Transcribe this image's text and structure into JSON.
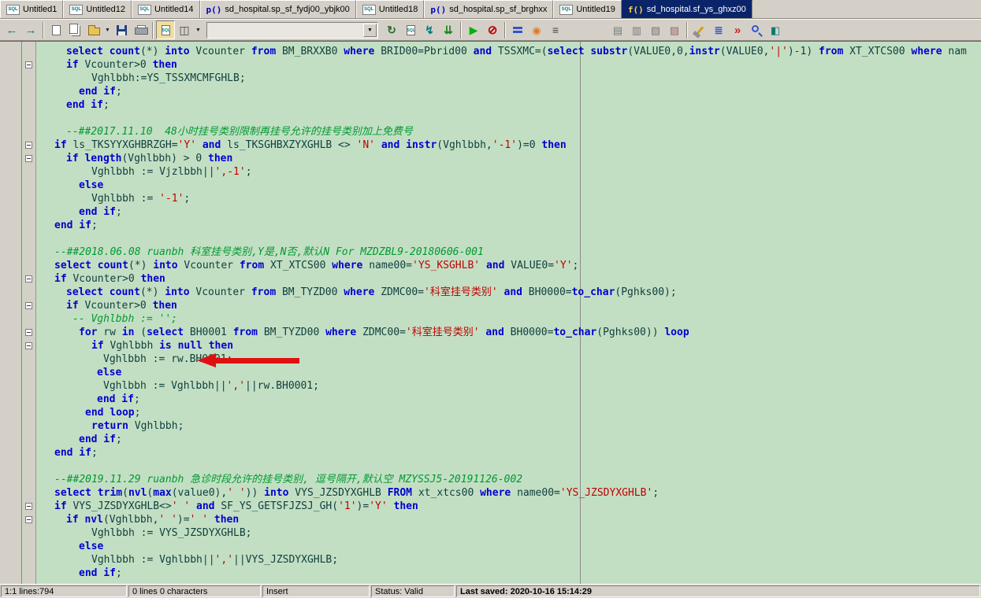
{
  "colors": {
    "window_bg": "#d4d0c8",
    "editor_bg": "#c3dfc3",
    "keyword": "#0000d0",
    "string": "#c00000",
    "comment": "#009933",
    "text": "#0e3e3e",
    "active_tab_bg": "#0a246a",
    "annotation_arrow": "#e01010"
  },
  "tab_icons": {
    "sql-window-icon": "SQL",
    "procedure-icon": "p()",
    "function-icon": "f()"
  },
  "tabs": [
    {
      "label": "Untitled1",
      "icon": "sql-window-icon",
      "active": false
    },
    {
      "label": "Untitled12",
      "icon": "sql-window-icon",
      "active": false
    },
    {
      "label": "Untitled14",
      "icon": "sql-window-icon",
      "active": false
    },
    {
      "label": "sd_hospital.sp_sf_fydj00_ybjk00",
      "icon": "procedure-icon",
      "active": false
    },
    {
      "label": "Untitled18",
      "icon": "sql-window-icon",
      "active": false
    },
    {
      "label": "sd_hospital.sp_sf_brghxx",
      "icon": "procedure-icon",
      "active": false
    },
    {
      "label": "Untitled19",
      "icon": "sql-window-icon",
      "active": false
    },
    {
      "label": "sd_hospital.sf_ys_ghxz00",
      "icon": "function-icon",
      "active": true
    }
  ],
  "toolbar": {
    "combo_value": "",
    "items": [
      {
        "type": "button",
        "name": "back-button",
        "icon": "arrow-left-icon"
      },
      {
        "type": "button",
        "name": "forward-button",
        "icon": "arrow-right-icon"
      },
      {
        "type": "sep"
      },
      {
        "type": "button",
        "name": "new-button",
        "icon": "new-page-icon"
      },
      {
        "type": "button",
        "name": "new-instance-button",
        "icon": "template-icon"
      },
      {
        "type": "button",
        "name": "open-button",
        "icon": "folder-icon",
        "dropdown": true
      },
      {
        "type": "button",
        "name": "save-button",
        "icon": "floppy-icon"
      },
      {
        "type": "button",
        "name": "print-button",
        "icon": "printer-icon"
      },
      {
        "type": "sep"
      },
      {
        "type": "button",
        "name": "sql-window-button",
        "icon": "sql-edit-icon",
        "pressed": true
      },
      {
        "type": "button",
        "name": "window-layout-button",
        "icon": "split-window-icon",
        "dropdown": true
      },
      {
        "type": "combo",
        "name": "session-selector-combo"
      },
      {
        "type": "button",
        "name": "refresh-button",
        "icon": "refresh-icon"
      },
      {
        "type": "button",
        "name": "execute-sql-button",
        "icon": "sql-page-icon"
      },
      {
        "type": "button",
        "name": "run-script-button",
        "icon": "lightning-icon"
      },
      {
        "type": "button",
        "name": "fetch-next-button",
        "icon": "double-down-icon"
      },
      {
        "type": "sep"
      },
      {
        "type": "button",
        "name": "execute-button",
        "icon": "play-icon"
      },
      {
        "type": "button",
        "name": "break-button",
        "icon": "stop-icon"
      },
      {
        "type": "sep"
      },
      {
        "type": "button",
        "name": "step-button",
        "icon": "dashes-icon"
      },
      {
        "type": "button",
        "name": "profiler-button",
        "icon": "donut-icon"
      },
      {
        "type": "button",
        "name": "statistics-button",
        "icon": "list-lines-icon"
      },
      {
        "type": "gap"
      },
      {
        "type": "button",
        "name": "copy-button",
        "icon": "clipboard-icon"
      },
      {
        "type": "button",
        "name": "copy-special-button",
        "icon": "clipboard2-icon"
      },
      {
        "type": "button",
        "name": "paste-button",
        "icon": "clipboard3-icon"
      },
      {
        "type": "button",
        "name": "edit-clipboard-button",
        "icon": "clipboard4-icon"
      },
      {
        "type": "sep"
      },
      {
        "type": "button",
        "name": "beautifier-button",
        "icon": "broom-icon"
      },
      {
        "type": "button",
        "name": "todo-list-button",
        "icon": "todo-icon"
      },
      {
        "type": "button",
        "name": "macro-button",
        "icon": "quotes-icon"
      },
      {
        "type": "button",
        "name": "find-button",
        "icon": "magnifier-icon"
      },
      {
        "type": "button",
        "name": "color-mark-button",
        "icon": "two-tone-icon"
      }
    ]
  },
  "code": {
    "lines": [
      {
        "indent": 4,
        "tokens": [
          [
            "k",
            "select"
          ],
          [
            "p",
            " "
          ],
          [
            "k",
            "count"
          ],
          [
            "p",
            "(*) "
          ],
          [
            "k",
            "into"
          ],
          [
            "p",
            " Vcounter "
          ],
          [
            "k",
            "from"
          ],
          [
            "p",
            " BM_BRXXB0 "
          ],
          [
            "k",
            "where"
          ],
          [
            "p",
            " BRID00=Pbrid00 "
          ],
          [
            "k",
            "and"
          ],
          [
            "p",
            " TSSXMC=("
          ],
          [
            "k",
            "select"
          ],
          [
            "p",
            " "
          ],
          [
            "k",
            "substr"
          ],
          [
            "p",
            "(VALUE0,0,"
          ],
          [
            "k",
            "instr"
          ],
          [
            "p",
            "(VALUE0,"
          ],
          [
            "s",
            "'|'"
          ],
          [
            "p",
            ")-1) "
          ],
          [
            "k",
            "from"
          ],
          [
            "p",
            " XT_XTCS00 "
          ],
          [
            "k",
            "where"
          ],
          [
            "p",
            " nam"
          ]
        ]
      },
      {
        "indent": 4,
        "fold": true,
        "tokens": [
          [
            "k",
            "if"
          ],
          [
            "p",
            " Vcounter>0 "
          ],
          [
            "k",
            "then"
          ]
        ]
      },
      {
        "indent": 8,
        "tokens": [
          [
            "p",
            "Vghlbbh:=YS_TSSXMCMFGHLB;"
          ]
        ]
      },
      {
        "indent": 6,
        "tokens": [
          [
            "k",
            "end if"
          ],
          [
            "p",
            ";"
          ]
        ]
      },
      {
        "indent": 4,
        "tokens": [
          [
            "k",
            "end if"
          ],
          [
            "p",
            ";"
          ]
        ]
      },
      {
        "indent": 0,
        "tokens": []
      },
      {
        "indent": 4,
        "tokens": [
          [
            "c",
            "--##2017.11.10  48小时挂号类别限制再挂号允许的挂号类别加上免费号"
          ]
        ]
      },
      {
        "indent": 2,
        "fold": true,
        "tokens": [
          [
            "k",
            "if"
          ],
          [
            "p",
            " ls_TKSYYXGHBRZGH="
          ],
          [
            "s",
            "'Y'"
          ],
          [
            "p",
            " "
          ],
          [
            "k",
            "and"
          ],
          [
            "p",
            " ls_TKSGHBXZYXGHLB <> "
          ],
          [
            "s",
            "'N'"
          ],
          [
            "p",
            " "
          ],
          [
            "k",
            "and"
          ],
          [
            "p",
            " "
          ],
          [
            "k",
            "instr"
          ],
          [
            "p",
            "(Vghlbbh,"
          ],
          [
            "s",
            "'-1'"
          ],
          [
            "p",
            ")=0 "
          ],
          [
            "k",
            "then"
          ]
        ]
      },
      {
        "indent": 4,
        "fold": true,
        "tokens": [
          [
            "k",
            "if"
          ],
          [
            "p",
            " "
          ],
          [
            "k",
            "length"
          ],
          [
            "p",
            "(Vghlbbh) > 0 "
          ],
          [
            "k",
            "then"
          ]
        ]
      },
      {
        "indent": 8,
        "tokens": [
          [
            "p",
            "Vghlbbh := Vjzlbbh||"
          ],
          [
            "s",
            "',-1'"
          ],
          [
            "p",
            ";"
          ]
        ]
      },
      {
        "indent": 6,
        "tokens": [
          [
            "k",
            "else"
          ]
        ]
      },
      {
        "indent": 8,
        "tokens": [
          [
            "p",
            "Vghlbbh := "
          ],
          [
            "s",
            "'-1'"
          ],
          [
            "p",
            ";"
          ]
        ]
      },
      {
        "indent": 6,
        "tokens": [
          [
            "k",
            "end if"
          ],
          [
            "p",
            ";"
          ]
        ]
      },
      {
        "indent": 2,
        "tokens": [
          [
            "k",
            "end if"
          ],
          [
            "p",
            ";"
          ]
        ]
      },
      {
        "indent": 0,
        "tokens": []
      },
      {
        "indent": 2,
        "tokens": [
          [
            "c",
            "--##2018.06.08 ruanbh 科室挂号类别,Y是,N否,默认N For MZDZBL9-20180606-001"
          ]
        ]
      },
      {
        "indent": 2,
        "tokens": [
          [
            "k",
            "select"
          ],
          [
            "p",
            " "
          ],
          [
            "k",
            "count"
          ],
          [
            "p",
            "(*) "
          ],
          [
            "k",
            "into"
          ],
          [
            "p",
            " Vcounter "
          ],
          [
            "k",
            "from"
          ],
          [
            "p",
            " XT_XTCS00 "
          ],
          [
            "k",
            "where"
          ],
          [
            "p",
            " name00="
          ],
          [
            "s",
            "'YS_KSGHLB'"
          ],
          [
            "p",
            " "
          ],
          [
            "k",
            "and"
          ],
          [
            "p",
            " VALUE0="
          ],
          [
            "s",
            "'Y'"
          ],
          [
            "p",
            ";"
          ]
        ]
      },
      {
        "indent": 2,
        "fold": true,
        "tokens": [
          [
            "k",
            "if"
          ],
          [
            "p",
            " Vcounter>0 "
          ],
          [
            "k",
            "then"
          ]
        ]
      },
      {
        "indent": 4,
        "tokens": [
          [
            "k",
            "select"
          ],
          [
            "p",
            " "
          ],
          [
            "k",
            "count"
          ],
          [
            "p",
            "(*) "
          ],
          [
            "k",
            "into"
          ],
          [
            "p",
            " Vcounter "
          ],
          [
            "k",
            "from"
          ],
          [
            "p",
            " BM_TYZD00 "
          ],
          [
            "k",
            "where"
          ],
          [
            "p",
            " ZDMC00="
          ],
          [
            "s",
            "'科室挂号类别'"
          ],
          [
            "p",
            " "
          ],
          [
            "k",
            "and"
          ],
          [
            "p",
            " BH0000="
          ],
          [
            "k",
            "to_char"
          ],
          [
            "p",
            "(Pghks00);"
          ]
        ]
      },
      {
        "indent": 4,
        "fold": true,
        "tokens": [
          [
            "k",
            "if"
          ],
          [
            "p",
            " Vcounter>0 "
          ],
          [
            "k",
            "then"
          ]
        ]
      },
      {
        "indent": 5,
        "tokens": [
          [
            "c",
            "-- Vghlbbh := '';"
          ]
        ]
      },
      {
        "indent": 6,
        "fold": true,
        "tokens": [
          [
            "k",
            "for"
          ],
          [
            "p",
            " rw "
          ],
          [
            "k",
            "in"
          ],
          [
            "p",
            " ("
          ],
          [
            "k",
            "select"
          ],
          [
            "p",
            " BH0001 "
          ],
          [
            "k",
            "from"
          ],
          [
            "p",
            " BM_TYZD00 "
          ],
          [
            "k",
            "where"
          ],
          [
            "p",
            " ZDMC00="
          ],
          [
            "s",
            "'科室挂号类别'"
          ],
          [
            "p",
            " "
          ],
          [
            "k",
            "and"
          ],
          [
            "p",
            " BH0000="
          ],
          [
            "k",
            "to_char"
          ],
          [
            "p",
            "(Pghks00)) "
          ],
          [
            "k",
            "loop"
          ]
        ]
      },
      {
        "indent": 8,
        "fold": true,
        "tokens": [
          [
            "k",
            "if"
          ],
          [
            "p",
            " Vghlbbh "
          ],
          [
            "k",
            "is null"
          ],
          [
            "p",
            " "
          ],
          [
            "k",
            "then"
          ]
        ]
      },
      {
        "indent": 10,
        "tokens": [
          [
            "p",
            "Vghlbbh := rw.BH0001;"
          ]
        ]
      },
      {
        "indent": 9,
        "tokens": [
          [
            "k",
            "else"
          ]
        ]
      },
      {
        "indent": 10,
        "tokens": [
          [
            "p",
            "Vghlbbh := Vghlbbh||"
          ],
          [
            "s",
            "','"
          ],
          [
            "p",
            "||rw.BH0001;"
          ]
        ]
      },
      {
        "indent": 9,
        "tokens": [
          [
            "k",
            "end if"
          ],
          [
            "p",
            ";"
          ]
        ]
      },
      {
        "indent": 7,
        "tokens": [
          [
            "k",
            "end loop"
          ],
          [
            "p",
            ";"
          ]
        ]
      },
      {
        "indent": 8,
        "tokens": [
          [
            "k",
            "return"
          ],
          [
            "p",
            " Vghlbbh;"
          ]
        ]
      },
      {
        "indent": 6,
        "tokens": [
          [
            "k",
            "end if"
          ],
          [
            "p",
            ";"
          ]
        ]
      },
      {
        "indent": 2,
        "tokens": [
          [
            "k",
            "end if"
          ],
          [
            "p",
            ";"
          ]
        ]
      },
      {
        "indent": 0,
        "tokens": []
      },
      {
        "indent": 2,
        "tokens": [
          [
            "c",
            "--##2019.11.29 ruanbh 急诊时段允许的挂号类别, 逗号隔开,默认空 MZYSSJ5-20191126-002"
          ]
        ]
      },
      {
        "indent": 2,
        "tokens": [
          [
            "k",
            "select"
          ],
          [
            "p",
            " "
          ],
          [
            "k",
            "trim"
          ],
          [
            "p",
            "("
          ],
          [
            "k",
            "nvl"
          ],
          [
            "p",
            "("
          ],
          [
            "k",
            "max"
          ],
          [
            "p",
            "(value0),"
          ],
          [
            "s",
            "' '"
          ],
          [
            "p",
            ")) "
          ],
          [
            "k",
            "into"
          ],
          [
            "p",
            " VYS_JZSDYXGHLB "
          ],
          [
            "k",
            "FROM"
          ],
          [
            "p",
            " xt_xtcs00 "
          ],
          [
            "k",
            "where"
          ],
          [
            "p",
            " name00="
          ],
          [
            "s",
            "'YS_JZSDYXGHLB'"
          ],
          [
            "p",
            ";"
          ]
        ]
      },
      {
        "indent": 2,
        "fold": true,
        "tokens": [
          [
            "k",
            "if"
          ],
          [
            "p",
            " VYS_JZSDYXGHLB<>"
          ],
          [
            "s",
            "' '"
          ],
          [
            "p",
            " "
          ],
          [
            "k",
            "and"
          ],
          [
            "p",
            " SF_YS_GETSFJZSJ_GH("
          ],
          [
            "s",
            "'1'"
          ],
          [
            "p",
            ")="
          ],
          [
            "s",
            "'Y'"
          ],
          [
            "p",
            " "
          ],
          [
            "k",
            "then"
          ]
        ]
      },
      {
        "indent": 4,
        "fold": true,
        "tokens": [
          [
            "k",
            "if"
          ],
          [
            "p",
            " "
          ],
          [
            "k",
            "nvl"
          ],
          [
            "p",
            "(Vghlbbh,"
          ],
          [
            "s",
            "' '"
          ],
          [
            "p",
            ")="
          ],
          [
            "s",
            "' '"
          ],
          [
            "p",
            " "
          ],
          [
            "k",
            "then"
          ]
        ]
      },
      {
        "indent": 8,
        "tokens": [
          [
            "p",
            "Vghlbbh := VYS_JZSDYXGHLB;"
          ]
        ]
      },
      {
        "indent": 6,
        "tokens": [
          [
            "k",
            "else"
          ]
        ]
      },
      {
        "indent": 8,
        "tokens": [
          [
            "p",
            "Vghlbbh := Vghlbbh||"
          ],
          [
            "s",
            "','"
          ],
          [
            "p",
            "||VYS_JZSDYXGHLB;"
          ]
        ]
      },
      {
        "indent": 6,
        "tokens": [
          [
            "k",
            "end if"
          ],
          [
            "p",
            ";"
          ]
        ]
      }
    ]
  },
  "statusbar": {
    "panels": [
      {
        "text": "1:1 lines:794"
      },
      {
        "text": "0 lines 0 characters"
      },
      {
        "text": "Insert"
      },
      {
        "text": "Status: Valid"
      },
      {
        "text": "Last saved: 2020-10-16 15:14:29"
      }
    ]
  }
}
